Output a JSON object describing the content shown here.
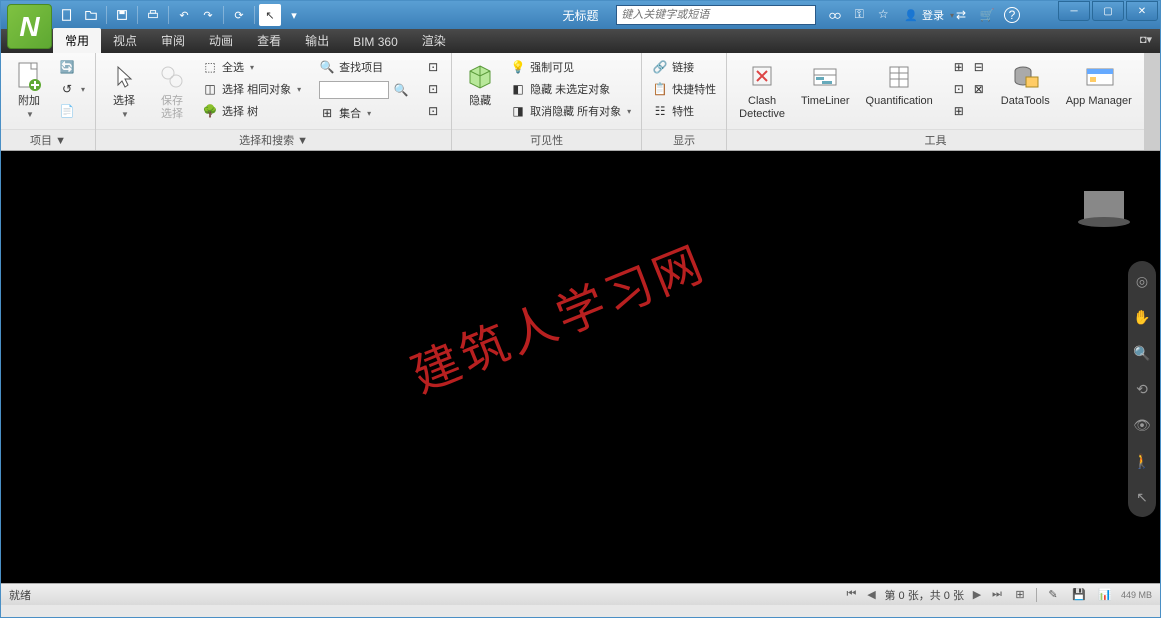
{
  "title": "无标题",
  "search": {
    "placeholder": "键入关键字或短语"
  },
  "login": "登录",
  "tabs": [
    "常用",
    "视点",
    "审阅",
    "动画",
    "查看",
    "输出",
    "BIM 360",
    "渲染"
  ],
  "ribbon": {
    "panel_project": {
      "append": "附加",
      "title": "项目 ▼"
    },
    "panel_select": {
      "select": "选择",
      "save_sel": "保存\n选择",
      "sel_all": "全选",
      "sel_same": "选择 相同对象",
      "sel_tree": "选择 树",
      "find": "查找项目",
      "sets": "集合",
      "title": "选择和搜索 ▼"
    },
    "panel_vis": {
      "hide": "隐藏",
      "force": "强制可见",
      "hide_unsel": "隐藏 未选定对象",
      "unhide_all": "取消隐藏 所有对象",
      "title": "可见性"
    },
    "panel_disp": {
      "links": "链接",
      "quick_props": "快捷特性",
      "props": "特性",
      "title": "显示"
    },
    "panel_tools": {
      "clash": "Clash\nDetective",
      "timeliner": "TimeLiner",
      "quant": "Quantification",
      "datatools": "DataTools",
      "appmgr": "App Manager",
      "title": "工具"
    }
  },
  "watermark": "建筑人学习网",
  "status": {
    "ready": "就绪",
    "pager": "第 0 张，共 0 张",
    "mem": "449 MB"
  }
}
